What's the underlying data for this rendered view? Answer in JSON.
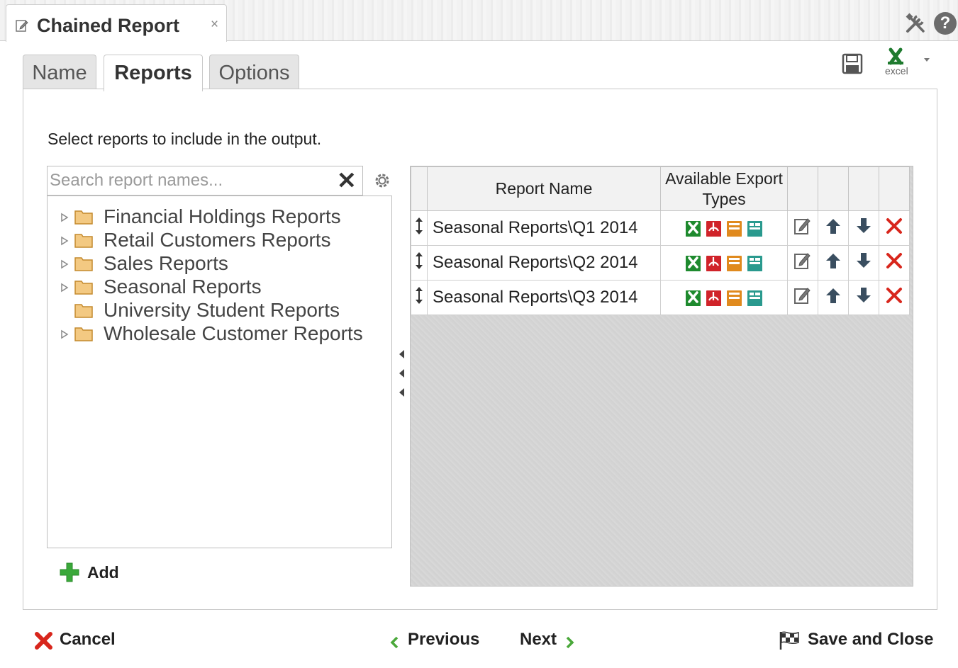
{
  "window": {
    "tab_title": "Chained Report",
    "close_glyph": "×",
    "tools_icon": "tools-icon",
    "help_glyph": "?"
  },
  "tabs": [
    {
      "label": "Name",
      "active": false
    },
    {
      "label": "Reports",
      "active": true
    },
    {
      "label": "Options",
      "active": false
    }
  ],
  "toolbar": {
    "save_icon": "save-icon",
    "excel_label": "excel"
  },
  "main": {
    "instruction": "Select reports to include in the output.",
    "search": {
      "placeholder": "Search report names...",
      "value": "",
      "clear_glyph": "✕"
    },
    "tree": [
      {
        "label": "Financial Holdings Reports",
        "expandable": true
      },
      {
        "label": "Retail Customers Reports",
        "expandable": true
      },
      {
        "label": "Sales Reports",
        "expandable": true
      },
      {
        "label": "Seasonal Reports",
        "expandable": true
      },
      {
        "label": "University Student Reports",
        "expandable": false
      },
      {
        "label": "Wholesale Customer Reports",
        "expandable": true
      }
    ],
    "add_label": "Add",
    "grid": {
      "col_report_name": "Report Name",
      "col_export_types": "Available Export Types",
      "export_types": [
        "excel",
        "pdf",
        "html",
        "csv"
      ],
      "rows": [
        {
          "name": "Seasonal Reports\\Q1 2014"
        },
        {
          "name": "Seasonal Reports\\Q2 2014"
        },
        {
          "name": "Seasonal Reports\\Q3 2014"
        }
      ]
    }
  },
  "footer": {
    "cancel_label": "Cancel",
    "previous_label": "Previous",
    "next_label": "Next",
    "save_close_label": "Save and Close"
  },
  "colors": {
    "excel": "#1e8a2e",
    "pdf": "#d0232a",
    "html": "#e08a1e",
    "csv": "#2a9a8e",
    "delete": "#d8261c",
    "add": "#3aa83a"
  }
}
